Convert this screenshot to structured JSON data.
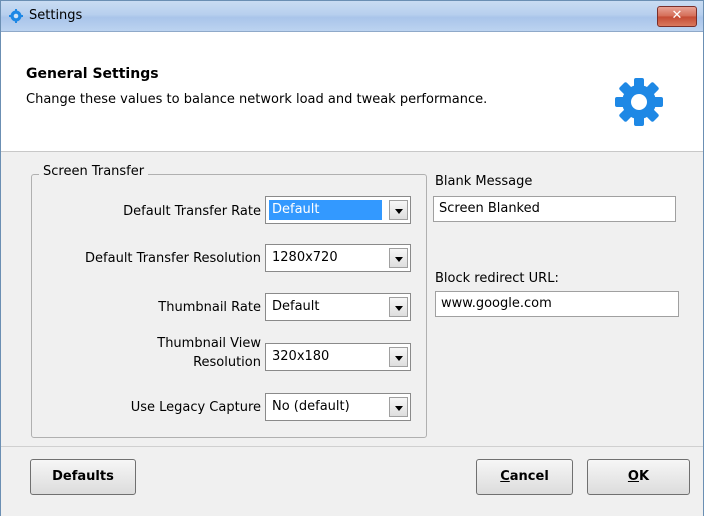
{
  "window": {
    "title": "Settings",
    "close_label": "✕"
  },
  "header": {
    "title": "General Settings",
    "description": "Change these values to balance network load and tweak performance."
  },
  "screen_transfer": {
    "group_label": "Screen Transfer",
    "rows": [
      {
        "label": "Default Transfer Rate",
        "value": "Default"
      },
      {
        "label": "Default Transfer Resolution",
        "value": "1280x720"
      },
      {
        "label": "Thumbnail Rate",
        "value": "Default"
      },
      {
        "label_line1": "Thumbnail View",
        "label_line2": "Resolution",
        "value": "320x180"
      },
      {
        "label": "Use Legacy Capture",
        "value": "No (default)"
      }
    ]
  },
  "blank_message": {
    "label": "Blank Message",
    "value": "Screen Blanked"
  },
  "block_redirect": {
    "label": "Block redirect URL:",
    "value": "www.google.com"
  },
  "buttons": {
    "defaults": "Defaults",
    "cancel_access": "C",
    "cancel_rest": "ancel",
    "ok_access": "O",
    "ok_rest": "K"
  },
  "colors": {
    "accent": "#3399ff",
    "gear": "#1e88e5",
    "close": "#c44a33"
  },
  "icons": {
    "app": "settings-app-icon",
    "header": "gear-icon",
    "close": "close-icon"
  }
}
